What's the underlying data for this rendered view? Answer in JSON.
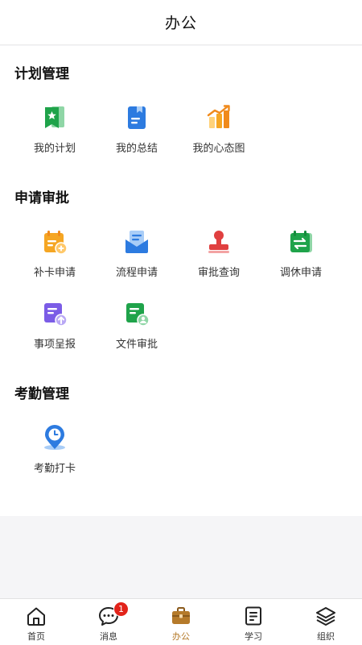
{
  "header": {
    "title": "办公"
  },
  "sections": [
    {
      "title": "计划管理",
      "items": [
        {
          "label": "我的计划",
          "icon": "plan-flag-icon"
        },
        {
          "label": "我的总结",
          "icon": "summary-document-icon"
        },
        {
          "label": "我的心态图",
          "icon": "mindset-chart-icon"
        }
      ]
    },
    {
      "title": "申请审批",
      "items": [
        {
          "label": "补卡申请",
          "icon": "calendar-add-icon"
        },
        {
          "label": "流程申请",
          "icon": "envelope-document-icon"
        },
        {
          "label": "审批查询",
          "icon": "approval-stamp-icon"
        },
        {
          "label": "调休申请",
          "icon": "calendar-swap-icon"
        },
        {
          "label": "事项呈报",
          "icon": "upload-report-icon"
        },
        {
          "label": "文件审批",
          "icon": "file-user-icon"
        }
      ]
    },
    {
      "title": "考勤管理",
      "items": [
        {
          "label": "考勤打卡",
          "icon": "clock-location-icon"
        }
      ]
    }
  ],
  "tabbar": {
    "tabs": [
      {
        "label": "首页",
        "icon": "home-icon"
      },
      {
        "label": "消息",
        "icon": "chat-bubble-icon",
        "badge": "1"
      },
      {
        "label": "办公",
        "icon": "briefcase-icon",
        "active": true
      },
      {
        "label": "学习",
        "icon": "book-icon"
      },
      {
        "label": "组织",
        "icon": "layers-icon"
      }
    ]
  },
  "colors": {
    "accent": "#b57a2a",
    "badge": "#e2231a",
    "green": "#1fa34a",
    "blue": "#2d7be0",
    "orange": "#f5a623",
    "red": "#e04040",
    "purple": "#7b5ce6"
  }
}
